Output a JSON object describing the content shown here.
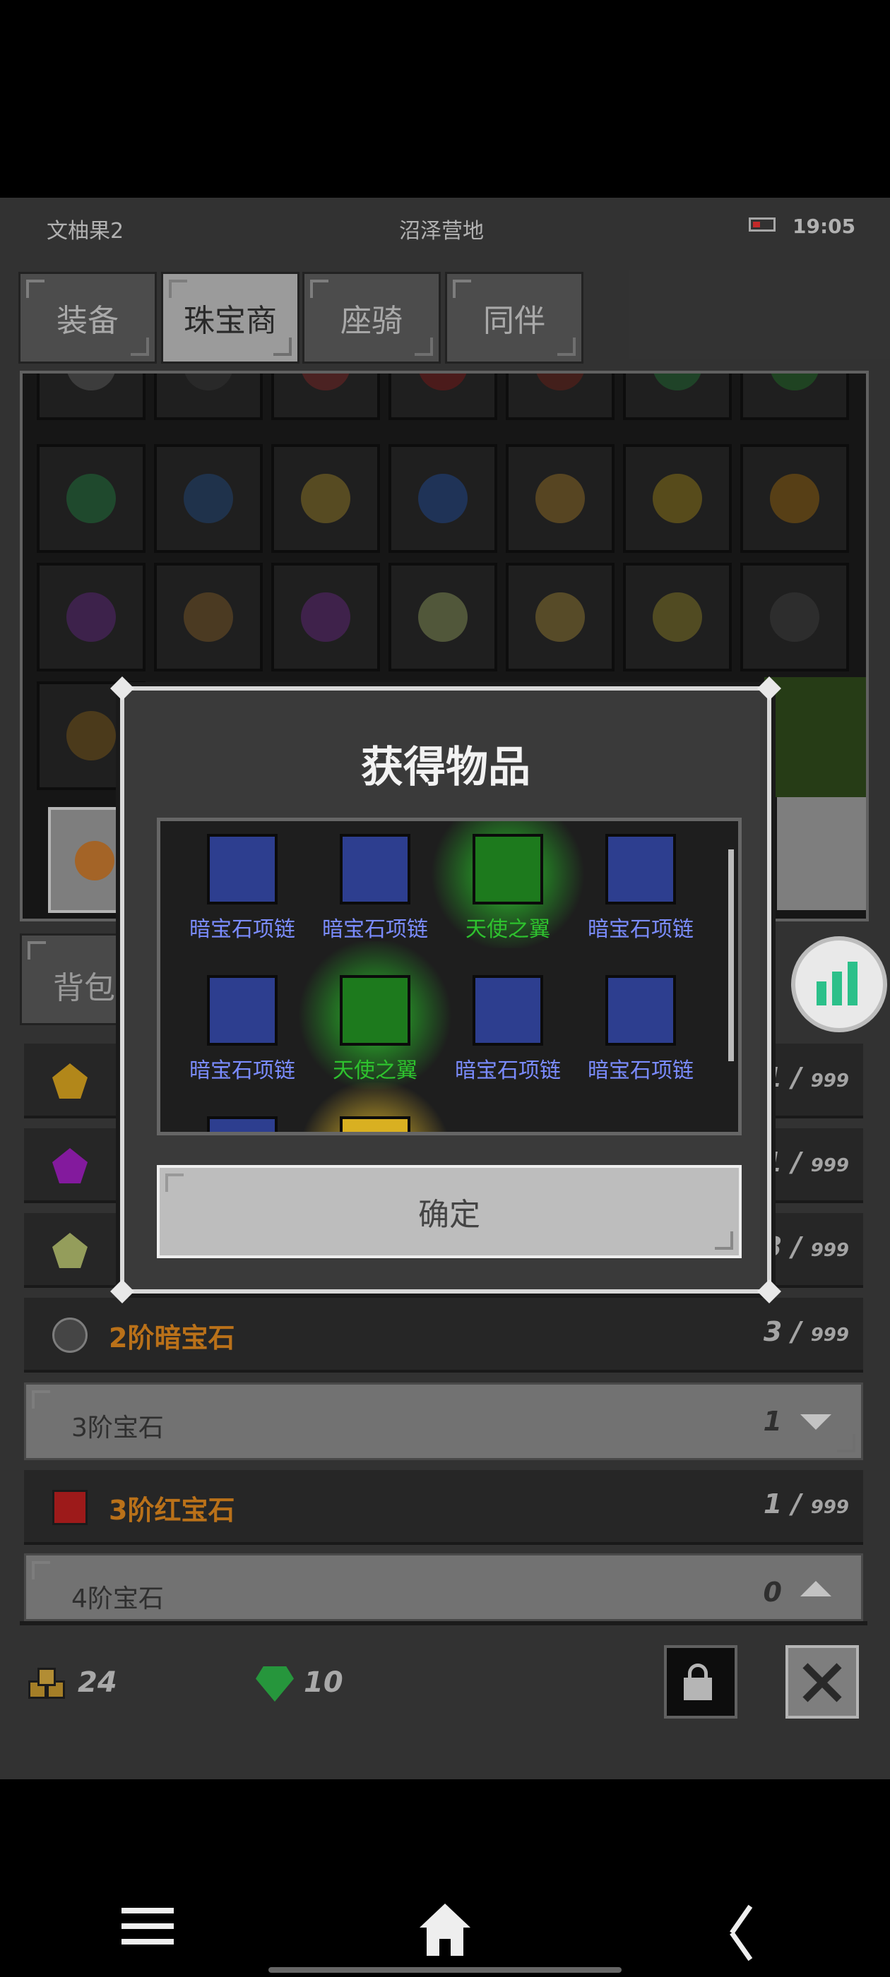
{
  "status": {
    "player_name": "文柚果2",
    "location": "沼泽营地",
    "time": "19:05"
  },
  "tabs": [
    {
      "label": "装备",
      "active": false
    },
    {
      "label": "珠宝商",
      "active": true
    },
    {
      "label": "座骑",
      "active": false
    },
    {
      "label": "同伴",
      "active": false
    }
  ],
  "backpack_tab": {
    "label": "背包"
  },
  "list": {
    "rows_top": [
      {
        "name": "",
        "count": "1",
        "max": "999",
        "icon": "gold-gem-icon",
        "color": "#d9a520"
      },
      {
        "name": "",
        "count": "11",
        "max": "999",
        "icon": "purple-gem-icon",
        "color": "#a020c0"
      },
      {
        "name": "",
        "count": "13",
        "max": "999",
        "icon": "green-gem-icon",
        "color": "#b5c070"
      }
    ],
    "dark_gem": {
      "name": "2阶暗宝石",
      "count": "3",
      "max": "999",
      "icon": "dark-gem-icon"
    },
    "tier3_header": {
      "label": "3阶宝石",
      "count": "1",
      "expanded": true
    },
    "ruby": {
      "name": "3阶红宝石",
      "count": "1",
      "max": "999",
      "icon": "ruby-icon"
    },
    "tier4_header": {
      "label": "4阶宝石",
      "count": "0",
      "expanded": false
    }
  },
  "currency": {
    "gold": "24",
    "gems": "10"
  },
  "modal": {
    "title": "获得物品",
    "confirm_label": "确定",
    "items": [
      {
        "label": "暗宝石项链",
        "rarity": "blue"
      },
      {
        "label": "暗宝石项链",
        "rarity": "blue"
      },
      {
        "label": "天使之翼",
        "rarity": "green"
      },
      {
        "label": "暗宝石项链",
        "rarity": "blue"
      },
      {
        "label": "暗宝石项链",
        "rarity": "blue"
      },
      {
        "label": "天使之翼",
        "rarity": "green"
      },
      {
        "label": "暗宝石项链",
        "rarity": "blue"
      },
      {
        "label": "暗宝石项链",
        "rarity": "blue"
      }
    ]
  },
  "colors": {
    "accent_orange": "#e38a1f",
    "rare_blue": "#7b8cff",
    "rare_green": "#2ec22e"
  }
}
